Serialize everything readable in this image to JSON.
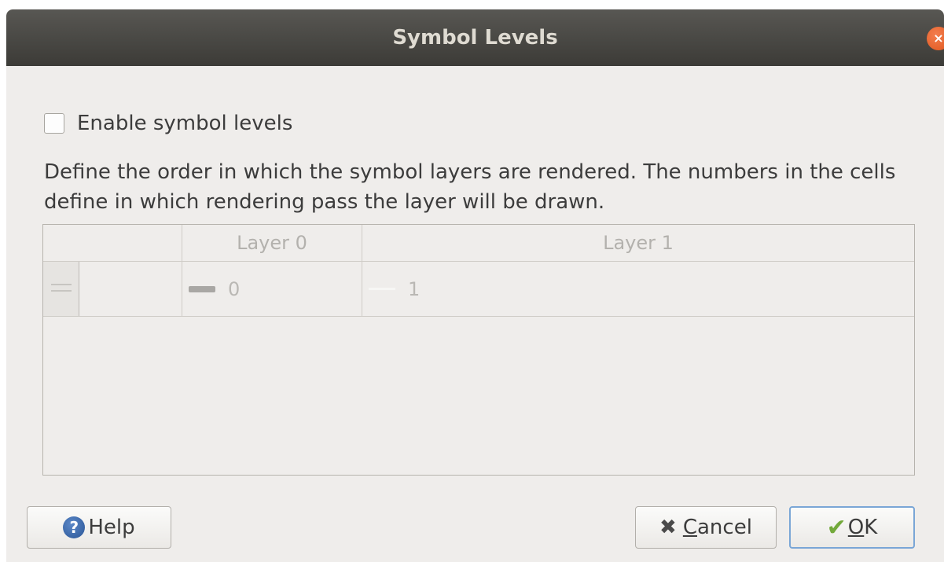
{
  "window": {
    "title": "Symbol Levels",
    "close_glyph": "×"
  },
  "checkbox": {
    "label": "Enable symbol levels",
    "checked": false
  },
  "description": "Define the order in which the symbol layers are rendered. The numbers in the cells define in which rendering pass the layer will be drawn.",
  "table": {
    "columns": [
      "Layer 0",
      "Layer 1"
    ],
    "rows": [
      {
        "cells": [
          {
            "value": "0",
            "swatch": "dark-line"
          },
          {
            "value": "1",
            "swatch": "light-line"
          }
        ]
      }
    ]
  },
  "buttons": {
    "help": {
      "icon_glyph": "?",
      "label": "Help"
    },
    "cancel": {
      "icon_glyph": "✖",
      "mnemonic": "C",
      "rest": "ancel"
    },
    "ok": {
      "icon_glyph": "✔",
      "mnemonic": "O",
      "rest": "K"
    }
  },
  "colors": {
    "titlebar": "#3c3b37",
    "close_button": "#e0571d",
    "ok_border": "#7aa6d6",
    "help_icon": "#2a5596",
    "ok_icon": "#73a93b"
  }
}
